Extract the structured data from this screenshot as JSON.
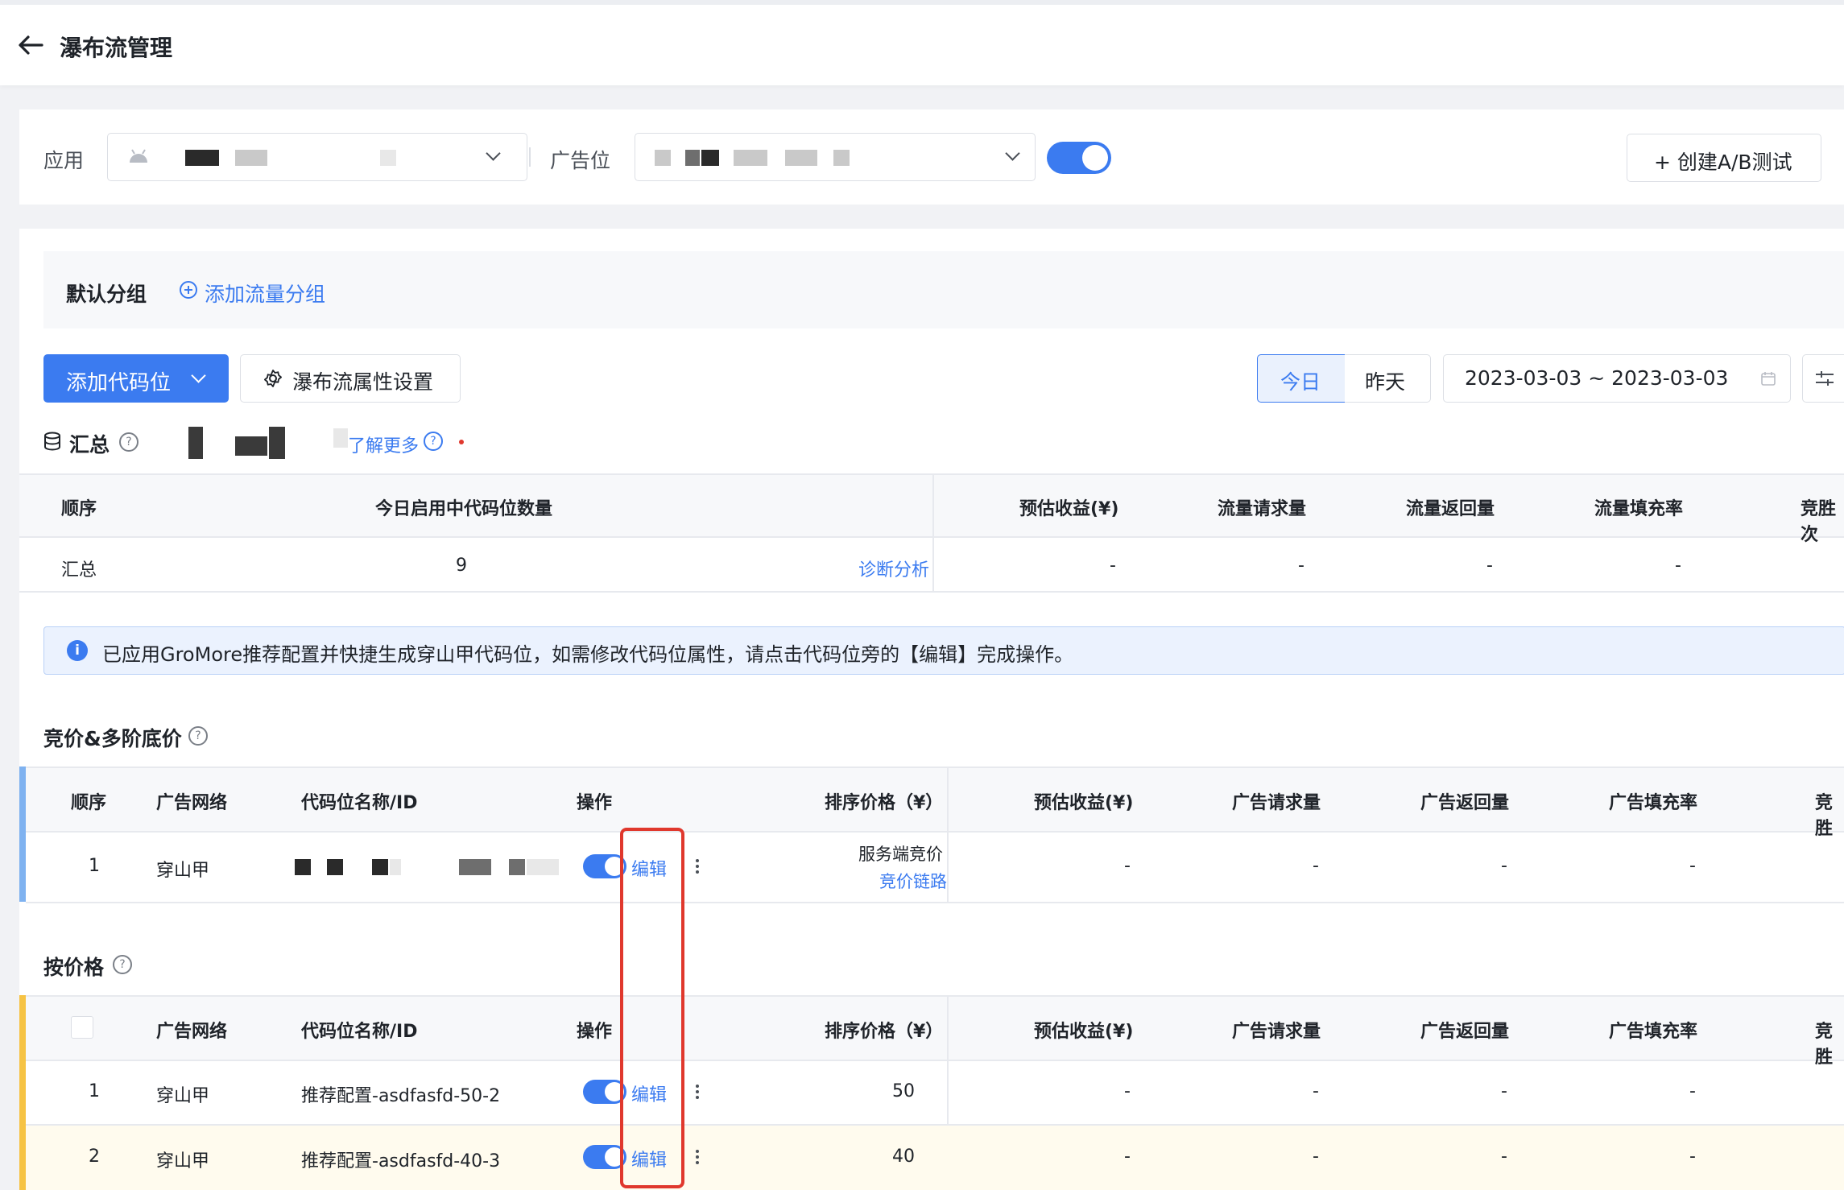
{
  "header": {
    "title": "瀑布流管理"
  },
  "filter": {
    "app_label": "应用",
    "adslot_label": "广告位",
    "create_ab_label": "+ 创建A/B测试"
  },
  "group": {
    "default_label": "默认分组",
    "add_group_label": "添加流量分组"
  },
  "toolbar": {
    "add_code_label": "添加代码位",
    "settings_label": "瀑布流属性设置",
    "today_label": "今日",
    "yesterday_label": "昨天",
    "date_range": "2023-03-03 ~ 2023-03-03"
  },
  "summary": {
    "title": "汇总",
    "learn_more": "了解更多",
    "headers": [
      "顺序",
      "今日启用中代码位数量",
      "预估收益(¥)",
      "流量请求量",
      "流量返回量",
      "流量填充率",
      "竞胜次"
    ],
    "row": {
      "label": "汇总",
      "count": "9",
      "diagnose": "诊断分析",
      "values": [
        "-",
        "-",
        "-",
        "-"
      ]
    }
  },
  "notice": {
    "text": "已应用GroMore推荐配置并快捷生成穿山甲代码位，如需修改代码位属性，请点击代码位旁的【编辑】完成操作。"
  },
  "bidding": {
    "title": "竞价&多阶底价",
    "headers": [
      "顺序",
      "广告网络",
      "代码位名称/ID",
      "操作",
      "排序价格（¥）",
      "预估收益(¥)",
      "广告请求量",
      "广告返回量",
      "广告填充率",
      "竞胜"
    ],
    "rows": [
      {
        "order": "1",
        "network": "穿山甲",
        "edit": "编辑",
        "price_line1": "服务端竞价",
        "price_line2": "竞价链路",
        "values": [
          "-",
          "-",
          "-",
          "-"
        ]
      }
    ]
  },
  "price": {
    "title": "按价格",
    "headers": [
      "广告网络",
      "代码位名称/ID",
      "操作",
      "排序价格（¥）",
      "预估收益(¥)",
      "广告请求量",
      "广告返回量",
      "广告填充率",
      "竞胜"
    ],
    "rows": [
      {
        "order": "1",
        "network": "穿山甲",
        "name": "推荐配置-asdfasfd-50-2",
        "edit": "编辑",
        "price": "50",
        "values": [
          "-",
          "-",
          "-",
          "-"
        ]
      },
      {
        "order": "2",
        "network": "穿山甲",
        "name": "推荐配置-asdfasfd-40-3",
        "edit": "编辑",
        "price": "40",
        "values": [
          "-",
          "-",
          "-",
          "-"
        ]
      }
    ]
  },
  "colors": {
    "accent": "#3b7bf0",
    "highlight": "#e0382d",
    "bidding_bar": "#7fb2f0",
    "price_bar": "#f6c344"
  },
  "icons": [
    "back-arrow-icon",
    "android-icon",
    "chevron-down-icon",
    "plus-circle-icon",
    "gear-icon",
    "calendar-icon",
    "database-icon",
    "help-icon",
    "info-icon",
    "kebab-icon"
  ]
}
